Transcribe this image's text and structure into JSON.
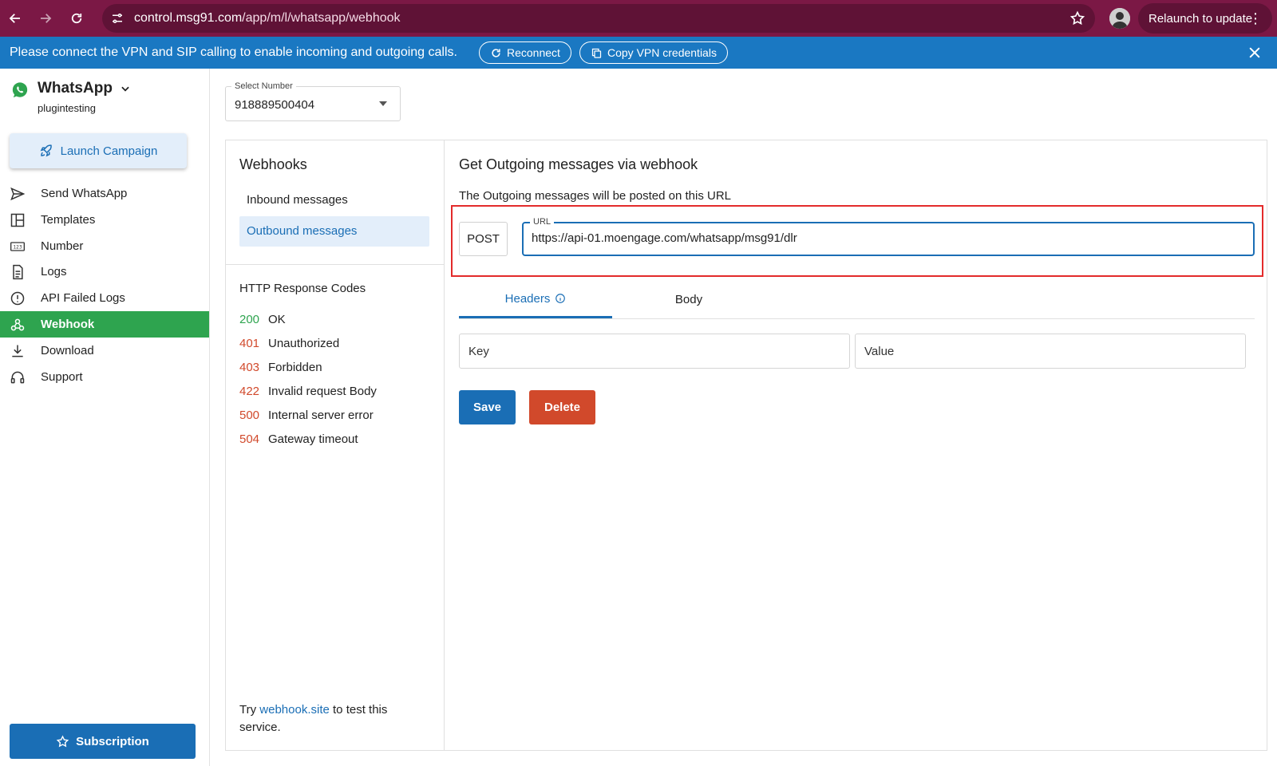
{
  "browser": {
    "url_host": "control.msg91.com",
    "url_path": "/app/m/l/whatsapp/webhook",
    "relaunch_label": "Relaunch to update",
    "icons": [
      "back-icon",
      "forward-icon",
      "reload-icon",
      "site-settings-icon",
      "star-icon",
      "menu-dots-icon"
    ]
  },
  "banner": {
    "message": "Please connect the VPN and SIP calling to enable incoming and outgoing calls.",
    "reconnect_label": "Reconnect",
    "copy_label": "Copy VPN credentials"
  },
  "sidebar": {
    "app_name": "WhatsApp",
    "account": "plugintesting",
    "launch_label": "Launch Campaign",
    "items": [
      {
        "label": "Send WhatsApp",
        "icon": "send-icon"
      },
      {
        "label": "Templates",
        "icon": "templates-icon"
      },
      {
        "label": "Number",
        "icon": "number-icon"
      },
      {
        "label": "Logs",
        "icon": "logs-icon"
      },
      {
        "label": "API Failed Logs",
        "icon": "alert-icon"
      },
      {
        "label": "Webhook",
        "icon": "webhook-icon",
        "active": true
      },
      {
        "label": "Download",
        "icon": "download-icon"
      },
      {
        "label": "Support",
        "icon": "headset-icon"
      }
    ],
    "subscription_label": "Subscription"
  },
  "select_number": {
    "label": "Select Number",
    "value": "918889500404"
  },
  "webhooks_panel": {
    "title": "Webhooks",
    "tabs": [
      {
        "label": "Inbound messages",
        "active": false
      },
      {
        "label": "Outbound messages",
        "active": true
      }
    ],
    "codes_title": "HTTP Response Codes",
    "codes": [
      {
        "code": "200",
        "text": "OK",
        "ok": true
      },
      {
        "code": "401",
        "text": "Unauthorized",
        "ok": false
      },
      {
        "code": "403",
        "text": "Forbidden",
        "ok": false
      },
      {
        "code": "422",
        "text": "Invalid request Body",
        "ok": false
      },
      {
        "code": "500",
        "text": "Internal server error",
        "ok": false
      },
      {
        "code": "504",
        "text": "Gateway timeout",
        "ok": false
      }
    ],
    "try_prefix": "Try ",
    "try_link": "webhook.site",
    "try_suffix": " to test this service."
  },
  "outgoing": {
    "title": "Get Outgoing messages via webhook",
    "description": "The Outgoing messages will be posted on this URL",
    "method": "POST",
    "url_label": "URL",
    "url_value": "https://api-01.moengage.com/whatsapp/msg91/dlr",
    "tabs": {
      "headers": "Headers",
      "body": "Body"
    },
    "key_placeholder": "Key",
    "value_placeholder": "Value",
    "save_label": "Save",
    "delete_label": "Delete"
  },
  "colors": {
    "browser_bar": "#7b1845",
    "banner": "#1a78c2",
    "accent": "#1a6eb5",
    "active_nav": "#2ea44f",
    "delete": "#d1492b",
    "highlight": "#e32b2b"
  }
}
